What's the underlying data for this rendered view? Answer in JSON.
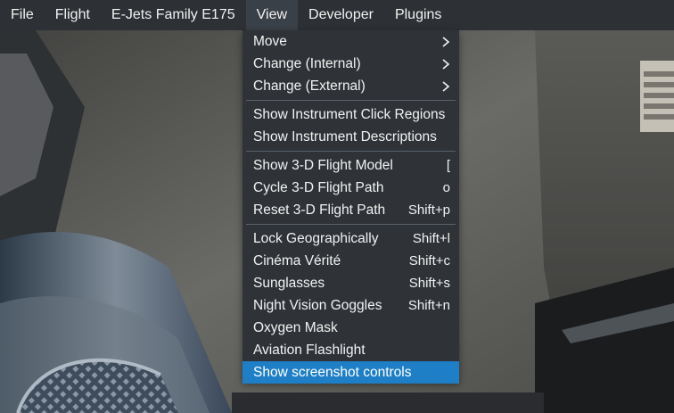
{
  "colors": {
    "menubar_bg": "#2d3135",
    "dropdown_bg": "#2f3338",
    "highlight": "#1e7fc6",
    "text": "#f2f2f2"
  },
  "menubar": {
    "items": [
      {
        "label": "File"
      },
      {
        "label": "Flight"
      },
      {
        "label": "E-Jets Family E175"
      },
      {
        "label": "View"
      },
      {
        "label": "Developer"
      },
      {
        "label": "Plugins"
      }
    ]
  },
  "view_menu": {
    "groups": [
      {
        "items": [
          {
            "label": "Move",
            "shortcut": "",
            "icon": "chevron-right-icon"
          },
          {
            "label": "Change (Internal)",
            "shortcut": "",
            "icon": "chevron-right-icon"
          },
          {
            "label": "Change (External)",
            "shortcut": "",
            "icon": "chevron-right-icon"
          }
        ]
      },
      {
        "items": [
          {
            "label": "Show Instrument Click Regions",
            "shortcut": ""
          },
          {
            "label": "Show Instrument Descriptions",
            "shortcut": ""
          }
        ]
      },
      {
        "items": [
          {
            "label": "Show 3-D Flight Model",
            "shortcut": "["
          },
          {
            "label": "Cycle 3-D Flight Path",
            "shortcut": "o"
          },
          {
            "label": "Reset 3-D Flight Path",
            "shortcut": "Shift+p"
          }
        ]
      },
      {
        "items": [
          {
            "label": "Lock Geographically",
            "shortcut": "Shift+l"
          },
          {
            "label": "Cinéma Vérité",
            "shortcut": "Shift+c"
          },
          {
            "label": "Sunglasses",
            "shortcut": "Shift+s"
          },
          {
            "label": "Night Vision Goggles",
            "shortcut": "Shift+n"
          },
          {
            "label": "Oxygen Mask",
            "shortcut": ""
          },
          {
            "label": "Aviation Flashlight",
            "shortcut": ""
          },
          {
            "label": "Show screenshot controls",
            "shortcut": "",
            "highlighted": true
          }
        ]
      }
    ]
  }
}
